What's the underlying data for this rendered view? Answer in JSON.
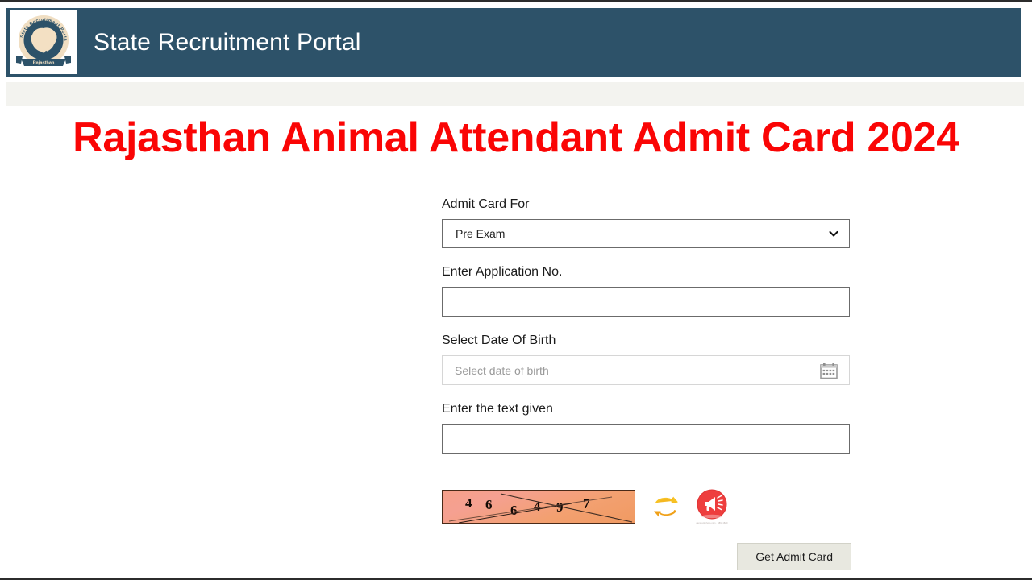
{
  "header": {
    "site_title": "State Recruitment Portal",
    "logo": {
      "icon": "rajasthan-state-emblem-icon",
      "arc_text_left": "State",
      "arc_text_top": "Recruitment",
      "arc_text_right": "Portal",
      "banner_text": "Rajasthan"
    },
    "background_color": "#2d5269"
  },
  "page": {
    "title": "Rajasthan Animal Attendant Admit Card 2024",
    "title_color": "#fa0505",
    "band_color": "#f3f3ef"
  },
  "form": {
    "admit_card_for": {
      "label": "Admit Card For",
      "selected": "Pre Exam",
      "options": [
        "Pre Exam"
      ],
      "chevron_icon": "chevron-down-icon"
    },
    "application_no": {
      "label": "Enter Application No.",
      "value": "",
      "placeholder": ""
    },
    "date_of_birth": {
      "label": "Select Date Of Birth",
      "value": "",
      "placeholder": "Select date of birth",
      "calendar_icon": "calendar-icon"
    },
    "captcha_text": {
      "label": "Enter the text given",
      "value": "",
      "placeholder": ""
    },
    "captcha": {
      "digits": [
        "4",
        "6",
        "6",
        "4",
        "9",
        "7"
      ],
      "code": "466497",
      "refresh_icon": "refresh-arrows-icon",
      "audio_icon": "speaker-megaphone-icon",
      "audio_watermark": "canstockphoto.com  ·  48941829",
      "background_colors": [
        "#f6a08a",
        "#f09a62"
      ],
      "border_color": "#4a2a18"
    },
    "submit": {
      "label": "Get Admit Card"
    }
  }
}
